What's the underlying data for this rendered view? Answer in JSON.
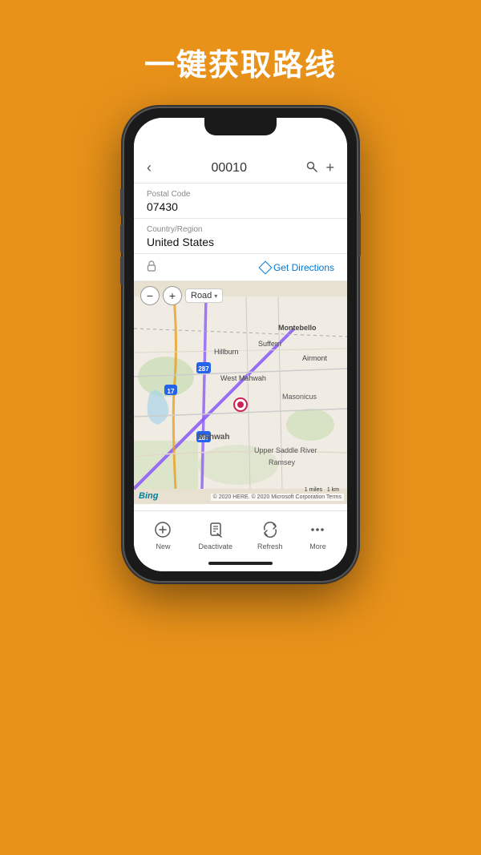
{
  "page": {
    "title": "一键获取路线",
    "background_color": "#E8921A"
  },
  "phone": {
    "header": {
      "back_label": "‹",
      "title": "00010",
      "search_icon": "🔍",
      "add_icon": "+"
    },
    "fields": [
      {
        "label": "Postal Code",
        "value": "07430"
      },
      {
        "label": "Country/Region",
        "value": "United States"
      }
    ],
    "actions": {
      "lock_icon": "🔒",
      "directions_label": "Get Directions"
    },
    "map": {
      "zoom_minus": "−",
      "zoom_plus": "+",
      "map_type": "Road",
      "dropdown_arrow": "▾",
      "attribution": "© 2020 HERE. © 2020 Microsoft Corporation Terms",
      "bing_label": "Bing",
      "scale_miles": "1 miles",
      "scale_km": "1 km"
    },
    "toolbar": [
      {
        "icon": "new",
        "label": "New"
      },
      {
        "icon": "deactivate",
        "label": "Deactivate"
      },
      {
        "icon": "refresh",
        "label": "Refresh"
      },
      {
        "icon": "more",
        "label": "More"
      }
    ]
  }
}
